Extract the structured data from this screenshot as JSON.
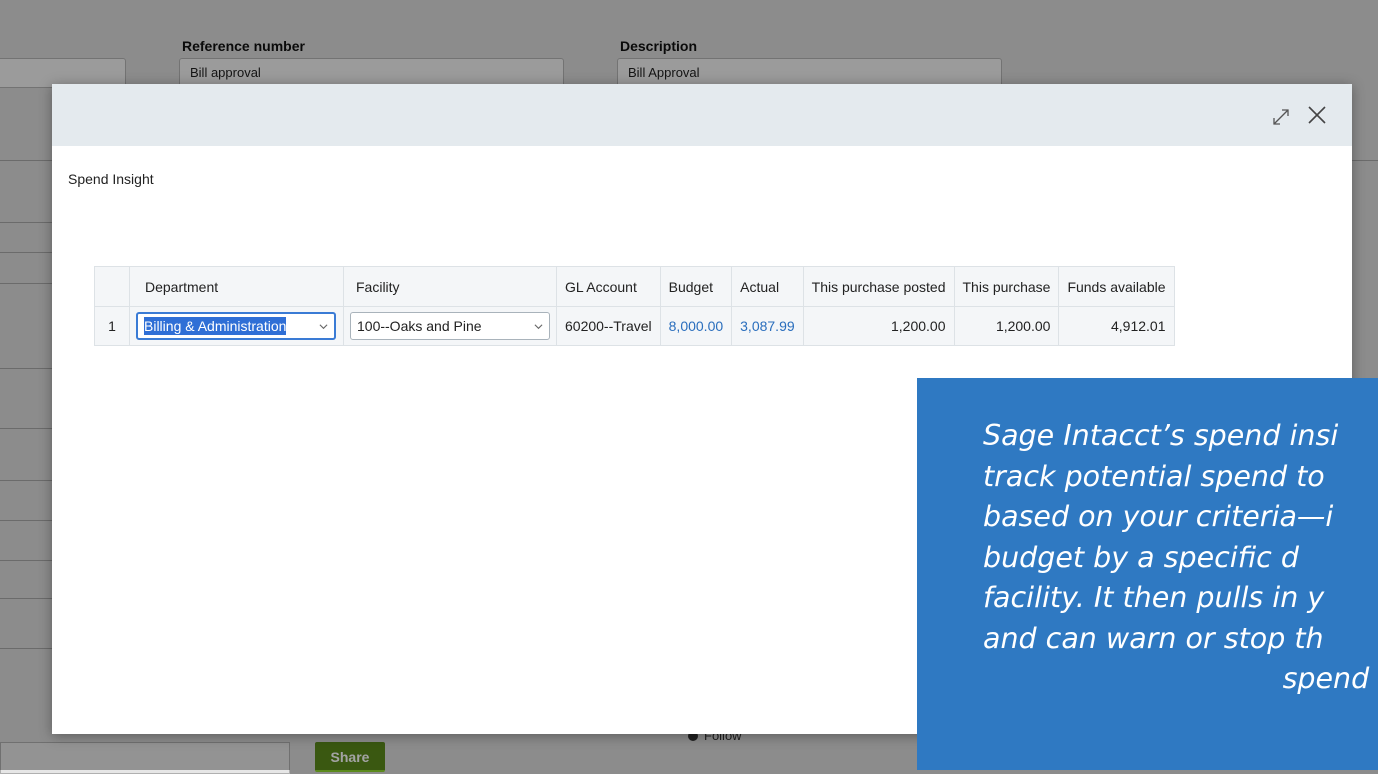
{
  "background": {
    "reference_label": "Reference number",
    "reference_value": "Bill approval",
    "description_label": "Description",
    "description_value": "Bill Approval",
    "share_button": "Share",
    "follow_link": "Follow"
  },
  "modal": {
    "title": "Spend Insight",
    "expand_icon": "expand-icon",
    "close_icon": "close-icon"
  },
  "table": {
    "columns": [
      "",
      "Department",
      "Facility",
      "GL Account",
      "Budget",
      "Actual",
      "This purchase posted",
      "This purchase",
      "Funds available"
    ],
    "rows": [
      {
        "row_number": "1",
        "department": "Billing & Administration",
        "facility": "100--Oaks and Pine",
        "gl_account": "60200--Travel",
        "budget": "8,000.00",
        "actual": "3,087.99",
        "this_purchase_posted": "1,200.00",
        "this_purchase": "1,200.00",
        "funds_available": "4,912.01"
      }
    ]
  },
  "callout": {
    "lines": [
      "Sage Intacct’s spend insi",
      "track potential spend to",
      "based on your criteria—i",
      "budget by a specific d",
      "facility. It then pulls in y",
      "and can warn or stop th",
      "spend if r"
    ]
  },
  "colors": {
    "modal_header": "#e4eaee",
    "link": "#2a6ebd",
    "callout": "#2f79c2",
    "share_button": "#5b8a1c"
  }
}
